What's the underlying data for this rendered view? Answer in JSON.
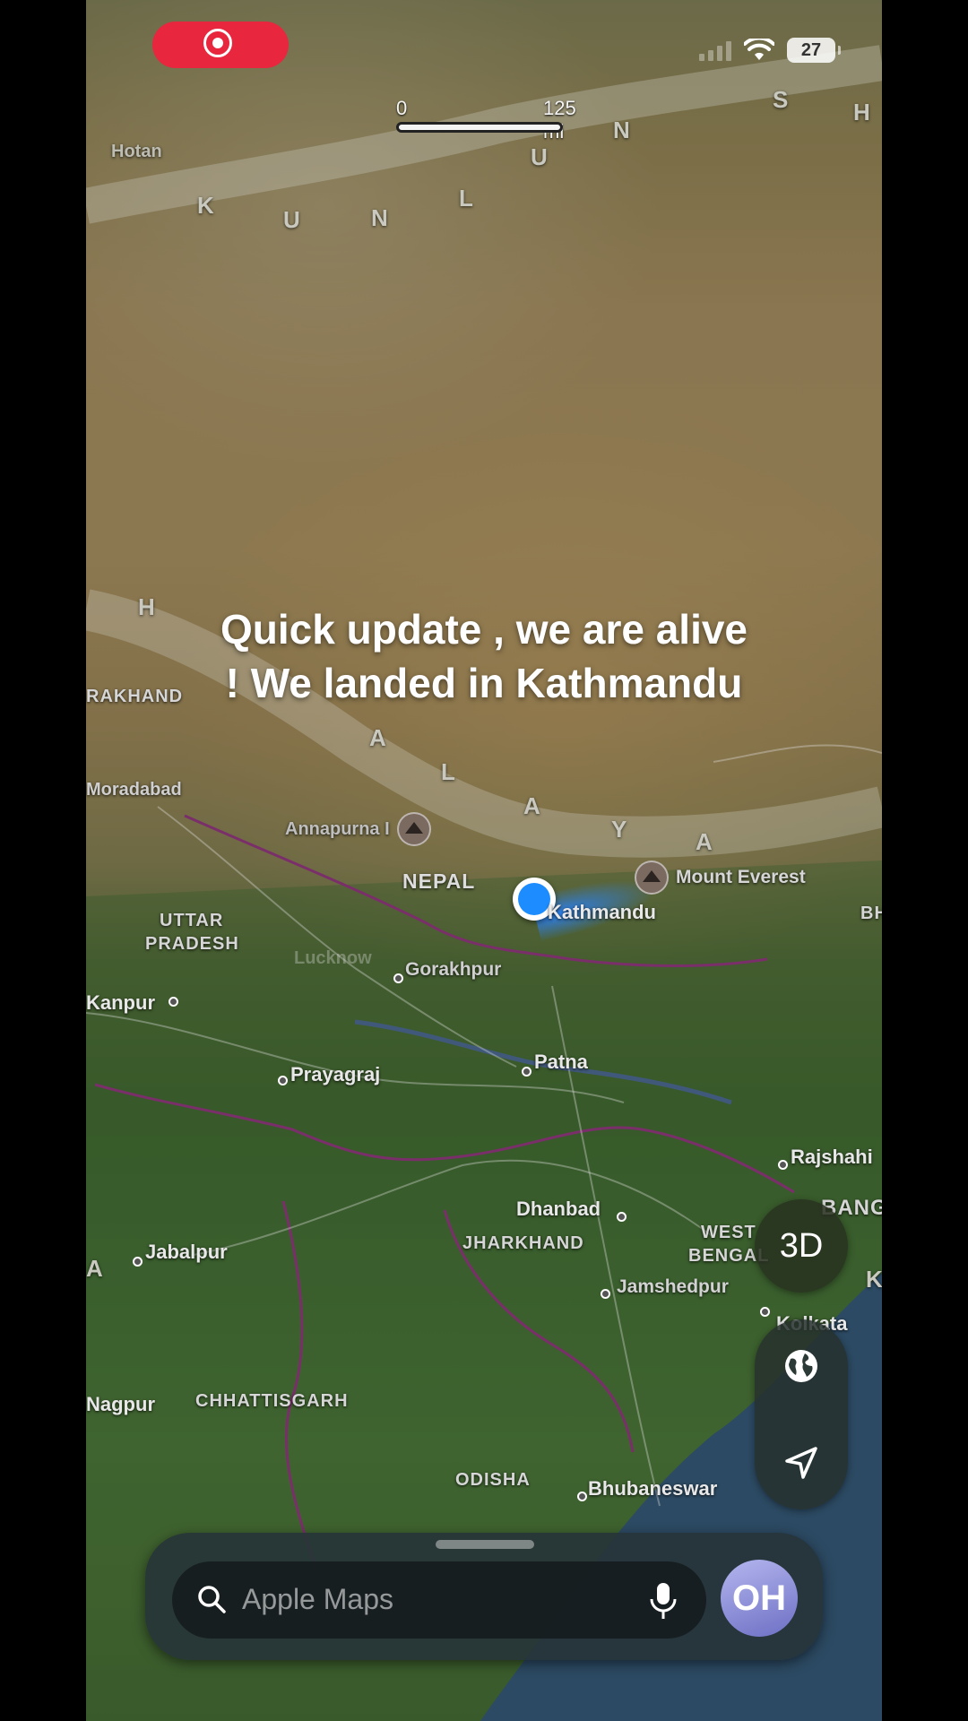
{
  "status_bar": {
    "battery": "27"
  },
  "scale": {
    "left": "0",
    "right": "125 mi"
  },
  "caption": {
    "line1": "Quick update , we are alive",
    "line2": "! We landed in Kathmandu"
  },
  "map": {
    "range_letters": [
      "K",
      "U",
      "N",
      "L",
      "U",
      "N",
      "S",
      "H",
      "H",
      "A",
      "L",
      "A",
      "Y",
      "A",
      "A",
      "K"
    ],
    "places": {
      "hotan": "Hotan",
      "rakhand": "RAKHAND",
      "moradabad": "Moradabad",
      "annapurna": "Annapurna I",
      "nepal": "NEPAL",
      "kathmandu": "Kathmandu",
      "everest": "Mount Everest",
      "bh": "BH",
      "uttar1": "UTTAR",
      "uttar2": "PRADESH",
      "lucknow": "Lucknow",
      "gorakhpur": "Gorakhpur",
      "kanpur": "Kanpur",
      "prayagraj": "Prayagraj",
      "patna": "Patna",
      "rajshahi": "Rajshahi",
      "bang": "BANG",
      "dhanbad": "Dhanbad",
      "jabalpur": "Jabalpur",
      "jharkhand": "JHARKHAND",
      "westbengal1": "WEST",
      "westbengal2": "BENGAL",
      "jamshedpur": "Jamshedpur",
      "kolkata": "Kolkata",
      "nagpur": "Nagpur",
      "chhattisgarh": "CHHATTISGARH",
      "odisha": "ODISHA",
      "bhubaneswar": "Bhubaneswar",
      "a_edge": "A"
    }
  },
  "controls": {
    "three_d": "3D",
    "globe_icon": "globe-icon",
    "location_icon": "location-arrow-icon"
  },
  "search": {
    "placeholder": "Apple Maps",
    "avatar_initials": "OH"
  },
  "colors": {
    "record": "#e8263e",
    "user_location": "#1d8cff",
    "avatar": "#8e90dc"
  }
}
